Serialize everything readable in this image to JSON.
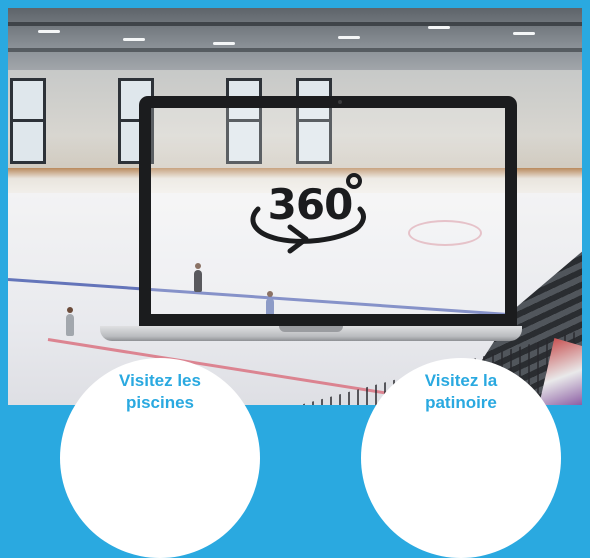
{
  "laptop": {
    "badge_text": "360"
  },
  "links": [
    {
      "label_line1": "Visitez les",
      "label_line2": "piscines"
    },
    {
      "label_line1": "Visitez la",
      "label_line2": "patinoire"
    }
  ],
  "colors": {
    "brand_blue": "#2aa9e0",
    "bubble_bg": "#ffffff",
    "laptop_bezel": "#1b1c1e"
  },
  "icons": {
    "rotate": "rotate-360-arrow-icon"
  }
}
